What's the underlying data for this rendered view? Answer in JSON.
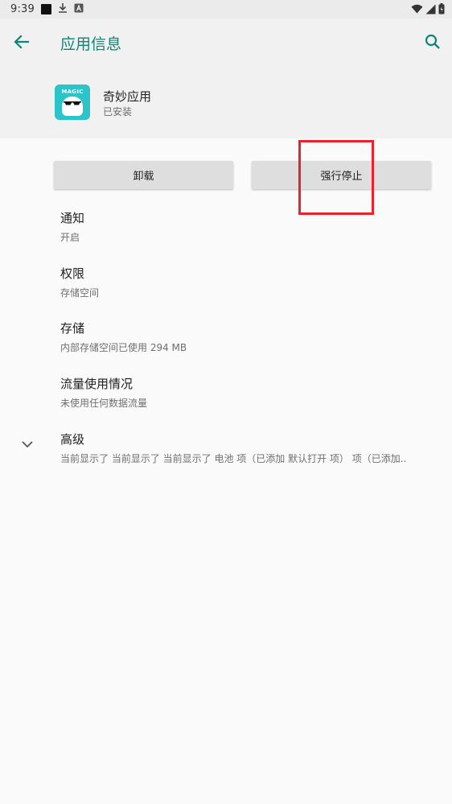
{
  "statusbar": {
    "time": "9:39"
  },
  "appbar": {
    "title": "应用信息"
  },
  "app": {
    "name": "奇妙应用",
    "status": "已安装",
    "icon_text": "MAGIC"
  },
  "buttons": {
    "uninstall": "卸载",
    "force_stop": "强行停止"
  },
  "items": [
    {
      "title": "通知",
      "subtitle": "开启"
    },
    {
      "title": "权限",
      "subtitle": "存储空间"
    },
    {
      "title": "存储",
      "subtitle": "内部存储空间已使用 294 MB"
    },
    {
      "title": "流量使用情况",
      "subtitle": "未使用任何数据流量"
    },
    {
      "title": "高级",
      "subtitle": "当前显示了 当前显示了 当前显示了 电池 项（已添加 默认打开 项） 项（已添加.."
    }
  ],
  "colors": {
    "accent": "#0d8578",
    "highlight": "#e6232e",
    "header_bg": "#f1f1f1"
  }
}
